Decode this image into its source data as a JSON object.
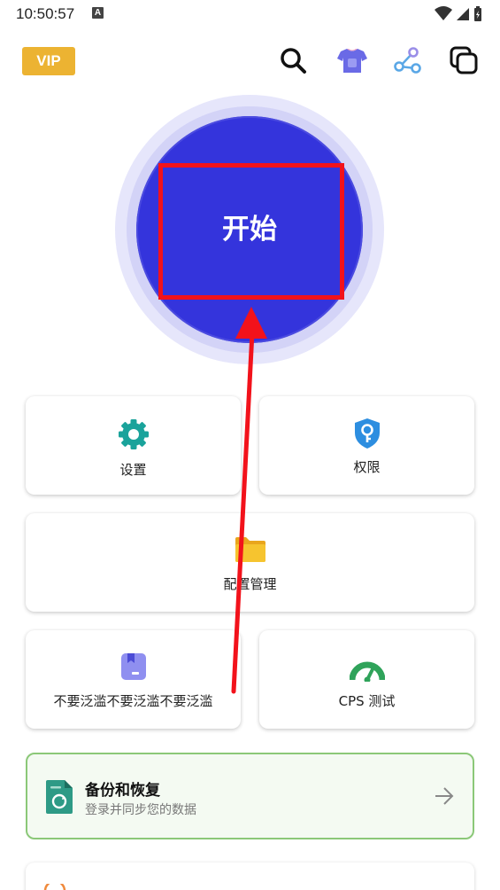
{
  "status_bar": {
    "time": "10:50:57",
    "notification_badge": "A"
  },
  "header": {
    "vip_label": "VIP",
    "icons": [
      "search-icon",
      "theme-shirt-icon",
      "share-icon",
      "copy-windows-icon"
    ]
  },
  "start_button": {
    "label": "开始"
  },
  "grid": {
    "settings_label": "设置",
    "permissions_label": "权限",
    "config_label": "配置管理",
    "repeat_label": "不要泛滥不要泛滥不要泛滥",
    "cps_label": "CPS 测试"
  },
  "backup": {
    "title": "备份和恢复",
    "subtitle": "登录并同步您的数据"
  },
  "colors": {
    "primary": "#3434dc",
    "vip": "#ecb332",
    "teal": "#1aa39b",
    "blue_icon": "#2d8ee0",
    "folder": "#f6c42f",
    "bookmark": "#8f8ff0",
    "gauge": "#2fa35a",
    "backup_border": "#8bc878",
    "annotation": "#f2121b"
  }
}
